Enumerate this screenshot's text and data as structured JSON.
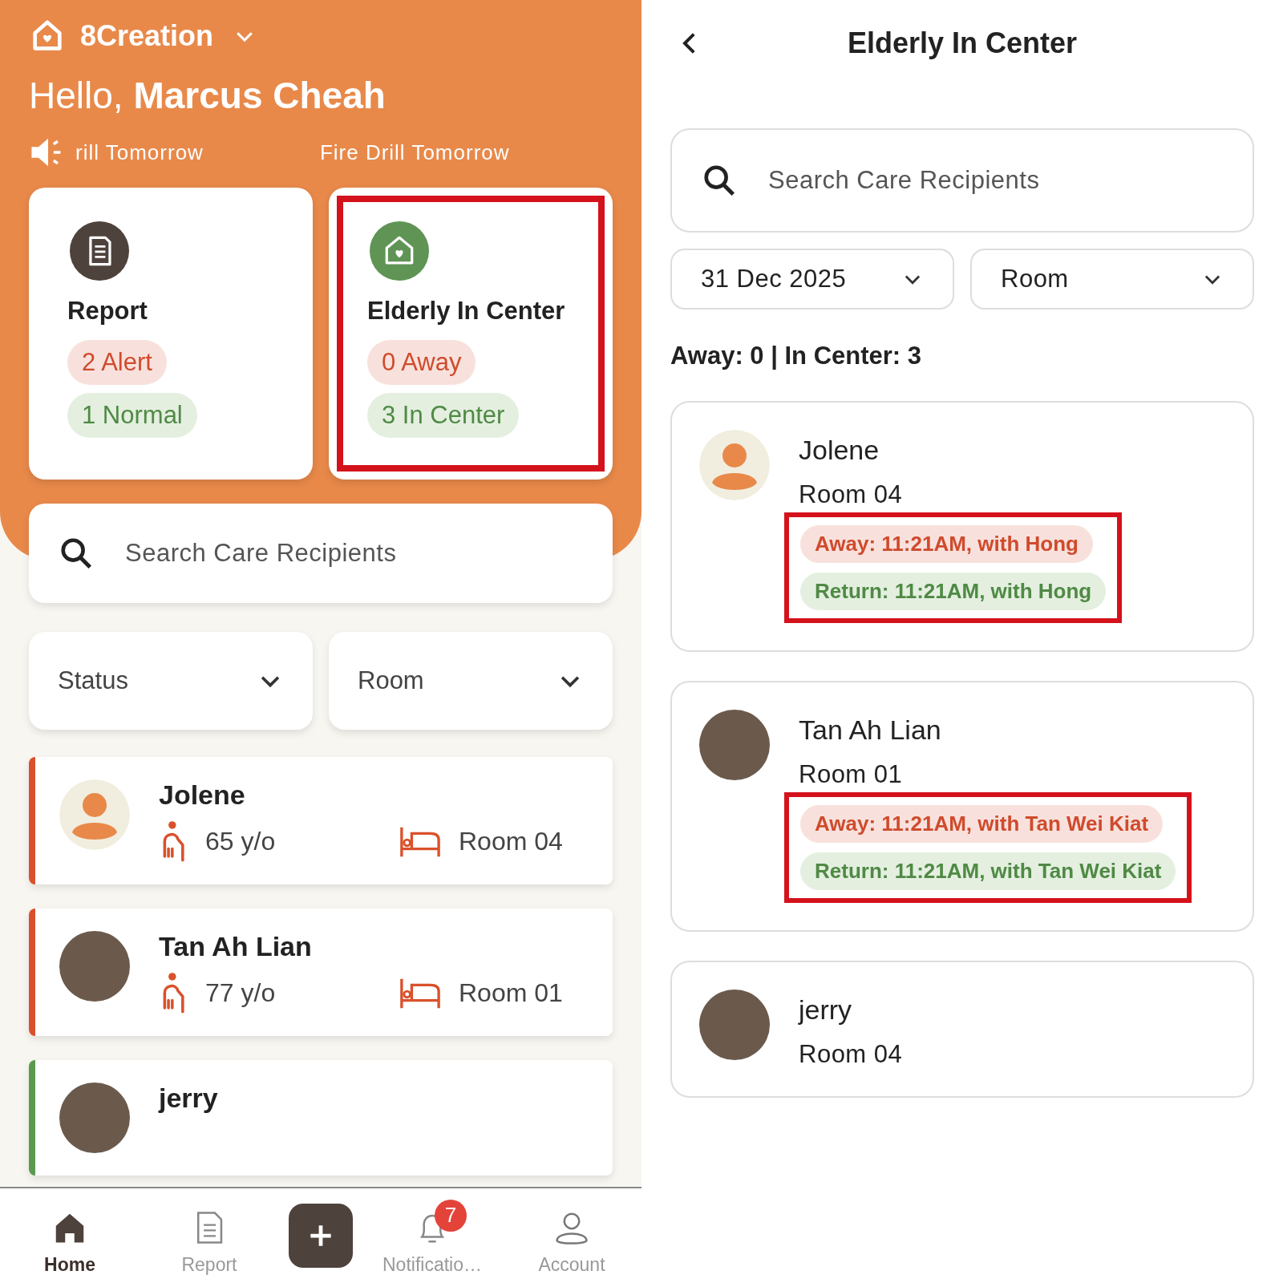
{
  "home": {
    "brand": "8Creation",
    "greeting": "Hello,",
    "user_name": "Marcus Cheah",
    "announcements": [
      "rill Tomorrow",
      "Fire Drill Tomorrow"
    ],
    "summary_cards": [
      {
        "kind": "report",
        "title": "Report",
        "highlighted": false,
        "pills": [
          {
            "kind": "alert",
            "text": "2 Alert"
          },
          {
            "kind": "normal",
            "text": "1 Normal"
          }
        ]
      },
      {
        "kind": "elderly",
        "title": "Elderly In Center",
        "highlighted": true,
        "pills": [
          {
            "kind": "alert",
            "text": "0 Away"
          },
          {
            "kind": "normal",
            "text": "3 In Center"
          }
        ]
      }
    ],
    "search": {
      "placeholder": "Search Care Recipients"
    },
    "filters": [
      {
        "label": "Status"
      },
      {
        "label": "Room"
      }
    ],
    "recipients": [
      {
        "name": "Jolene",
        "kind": "default",
        "age": "65 y/o",
        "room": "Room 04",
        "color": "#d9512c"
      },
      {
        "name": "Tan Ah Lian",
        "kind": "photo",
        "age": "77 y/o",
        "room": "Room 01",
        "color": "#d9512c"
      },
      {
        "name": "jerry",
        "kind": "photo",
        "color": "#5a9a4e"
      }
    ],
    "nav": [
      {
        "kind": "home",
        "label": "Home",
        "selected": true
      },
      {
        "kind": "report",
        "label": "Report",
        "selected": false
      },
      {
        "kind": "add"
      },
      {
        "kind": "notifications",
        "label": "Notificatio…",
        "badge": "7",
        "selected": false
      },
      {
        "kind": "account",
        "label": "Account",
        "selected": false
      }
    ]
  },
  "detail": {
    "title": "Elderly In Center",
    "search": {
      "placeholder": "Search Care Recipients"
    },
    "date_filter": "31 Dec 2025",
    "room_filter": "Room",
    "summary": "Away: 0 | In Center: 3",
    "recipients": [
      {
        "name": "Jolene",
        "kind": "default",
        "room": "Room 04",
        "highlighted": true,
        "events": [
          {
            "kind": "away",
            "text": "Away: 11:21AM, with Hong"
          },
          {
            "kind": "return",
            "text": "Return: 11:21AM, with Hong"
          }
        ]
      },
      {
        "name": "Tan Ah Lian",
        "kind": "photo",
        "room": "Room 01",
        "highlighted": true,
        "events": [
          {
            "kind": "away",
            "text": "Away: 11:21AM, with Tan Wei Kiat"
          },
          {
            "kind": "return",
            "text": "Return: 11:21AM, with Tan Wei Kiat"
          }
        ]
      },
      {
        "name": "jerry",
        "kind": "photo",
        "room": "Room 04"
      }
    ]
  }
}
